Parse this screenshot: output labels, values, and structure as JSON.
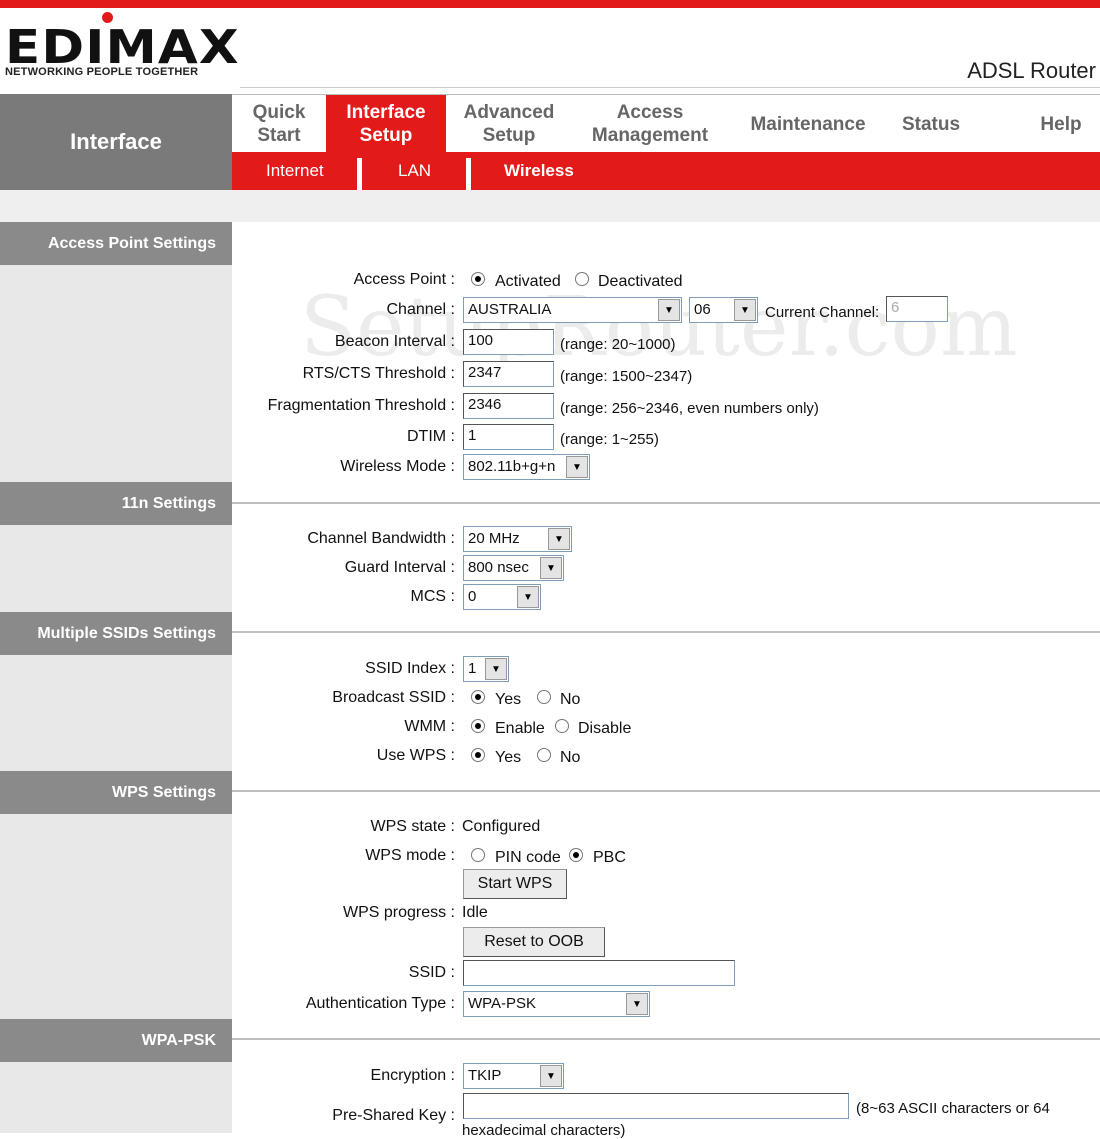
{
  "header": {
    "brand": "EDIMAX",
    "tagline": "NETWORKING PEOPLE TOGETHER",
    "product": "ADSL Router"
  },
  "watermark": "SetupRouter.com",
  "nav": {
    "section_title": "Interface",
    "menu": [
      {
        "label": "Quick\nStart"
      },
      {
        "label": "Interface\nSetup"
      },
      {
        "label": "Advanced\nSetup"
      },
      {
        "label": "Access\nManagement"
      },
      {
        "label": "Maintenance"
      },
      {
        "label": "Status"
      },
      {
        "label": "Help"
      }
    ],
    "submenu": [
      {
        "label": "Internet"
      },
      {
        "label": "LAN"
      },
      {
        "label": "Wireless"
      }
    ]
  },
  "sections": {
    "ap": "Access Point Settings",
    "n11": "11n Settings",
    "mssid": "Multiple SSIDs Settings",
    "wps": "WPS Settings",
    "wpapsk": "WPA-PSK"
  },
  "ap": {
    "access_point_label": "Access Point :",
    "activated": "Activated",
    "deactivated": "Deactivated",
    "channel_label": "Channel :",
    "channel_region": "AUSTRALIA",
    "channel_value": "06",
    "current_channel_label": "Current Channel:",
    "current_channel_value": "6",
    "beacon_label": "Beacon Interval :",
    "beacon_value": "100",
    "beacon_range": "(range: 20~1000)",
    "rts_label": "RTS/CTS Threshold :",
    "rts_value": "2347",
    "rts_range": "(range: 1500~2347)",
    "frag_label": "Fragmentation Threshold :",
    "frag_value": "2346",
    "frag_range": "(range: 256~2346, even numbers only)",
    "dtim_label": "DTIM :",
    "dtim_value": "1",
    "dtim_range": "(range: 1~255)",
    "mode_label": "Wireless Mode :",
    "mode_value": "802.11b+g+n"
  },
  "n11": {
    "bw_label": "Channel Bandwidth :",
    "bw_value": "20 MHz",
    "gi_label": "Guard Interval :",
    "gi_value": "800 nsec",
    "mcs_label": "MCS :",
    "mcs_value": "0"
  },
  "mssid": {
    "index_label": "SSID Index :",
    "index_value": "1",
    "broadcast_label": "Broadcast SSID :",
    "yes": "Yes",
    "no": "No",
    "wmm_label": "WMM :",
    "enable": "Enable",
    "disable": "Disable",
    "usewps_label": "Use WPS :"
  },
  "wps": {
    "state_label": "WPS state :",
    "state_value": "Configured",
    "mode_label": "WPS mode :",
    "pin": "PIN code",
    "pbc": "PBC",
    "start_button": "Start WPS",
    "progress_label": "WPS progress :",
    "progress_value": "Idle",
    "reset_button": "Reset to OOB",
    "ssid_label": "SSID :",
    "ssid_value": "",
    "auth_label": "Authentication Type :",
    "auth_value": "WPA-PSK"
  },
  "wpapsk": {
    "enc_label": "Encryption :",
    "enc_value": "TKIP",
    "psk_label": "Pre-Shared Key :",
    "psk_value": "",
    "psk_hint": "(8~63 ASCII characters or 64",
    "psk_hint2": "hexadecimal characters)"
  }
}
